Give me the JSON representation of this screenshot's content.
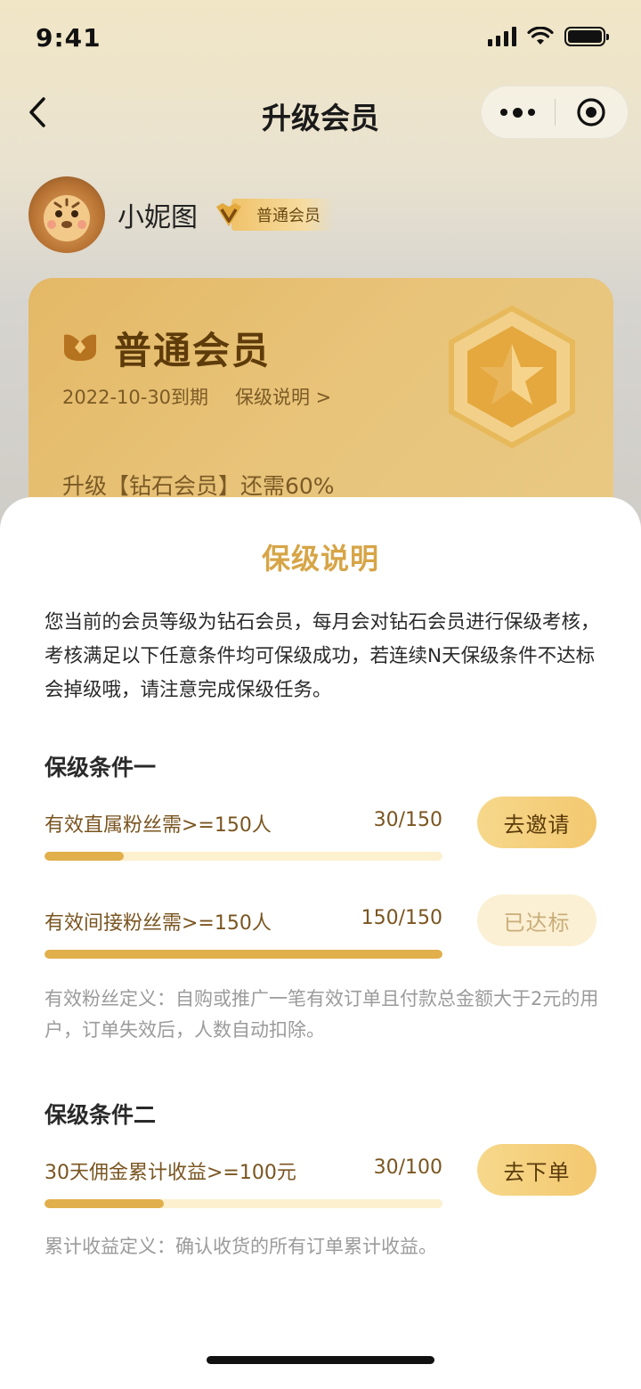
{
  "status_bar": {
    "time": "9:41"
  },
  "nav": {
    "title": "升级会员"
  },
  "profile": {
    "name": "小妮图",
    "level": "普通会员"
  },
  "card": {
    "title": "普通会员",
    "expiry": "2022-10-30到期",
    "link": "保级说明 >",
    "upgrade_text": "升级【钻石会员】还需60%"
  },
  "sheet": {
    "title": "保级说明",
    "intro": "您当前的会员等级为钻石会员，每月会对钻石会员进行保级考核，考核满足以下任意条件均可保级成功，若连续N天保级条件不达标会掉级哦，请注意完成保级任务。",
    "section1": {
      "title": "保级条件一",
      "conditions": [
        {
          "label": "有效直属粉丝需>=150人",
          "value": "30/150",
          "progress": 0.2,
          "button": "去邀请",
          "done": false
        },
        {
          "label": "有效间接粉丝需>=150人",
          "value": "150/150",
          "progress": 1.0,
          "button": "已达标",
          "done": true
        }
      ],
      "note": "有效粉丝定义：自购或推广一笔有效订单且付款总金额大于2元的用户，订单失效后，人数自动扣除。"
    },
    "section2": {
      "title": "保级条件二",
      "conditions": [
        {
          "label": "30天佣金累计收益>=100元",
          "value": "30/100",
          "progress": 0.3,
          "button": "去下单",
          "done": false
        }
      ],
      "note": "累计收益定义：确认收货的所有订单累计收益。"
    }
  },
  "colors": {
    "accent": "#d7a547",
    "progress": "#e1af4b",
    "track": "#fdf0cf"
  }
}
